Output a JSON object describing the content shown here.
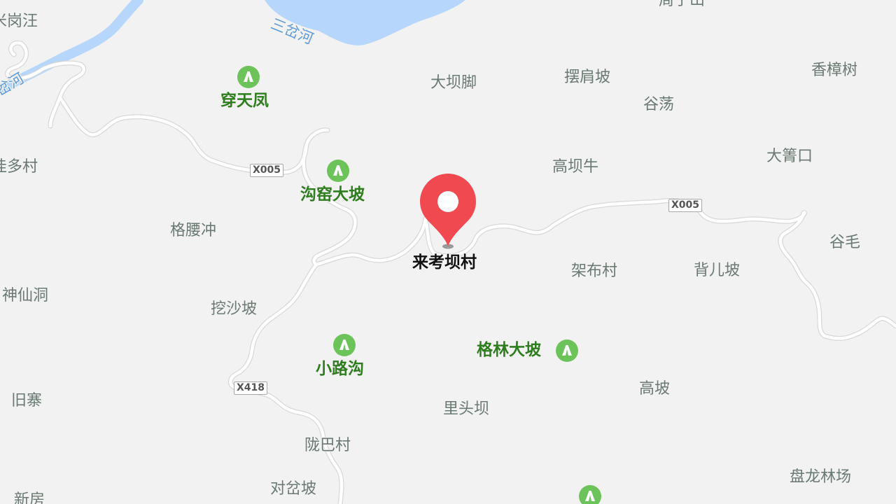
{
  "map": {
    "rivers": [
      "三岔河",
      "岔河"
    ],
    "roads": [
      "X005",
      "X005",
      "X418"
    ],
    "peaks": [
      "穿天凤",
      "沟窑大坡",
      "小路沟",
      "格林大坡"
    ],
    "places": [
      "米岗汪",
      "周子山",
      "大坝脚",
      "摆肩坡",
      "香樟树",
      "谷荡",
      "洼多村",
      "高坝牛",
      "大箐口",
      "格腰冲",
      "架布村",
      "背儿坡",
      "谷毛",
      "神仙洞",
      "挖沙坡",
      "高坡",
      "旧寨",
      "里头坝",
      "陇巴村",
      "对岔坡",
      "盘龙林场",
      "新房"
    ],
    "marker": {
      "title": "来考坝村",
      "color": "#f04a50"
    },
    "colors": {
      "background": "#f2f2f2",
      "water": "#b6d7fb",
      "road": "#ffffff",
      "peak_icon": "#6cc35a",
      "peak_label": "#2e7d1e",
      "place_label": "#6a7a72"
    }
  }
}
